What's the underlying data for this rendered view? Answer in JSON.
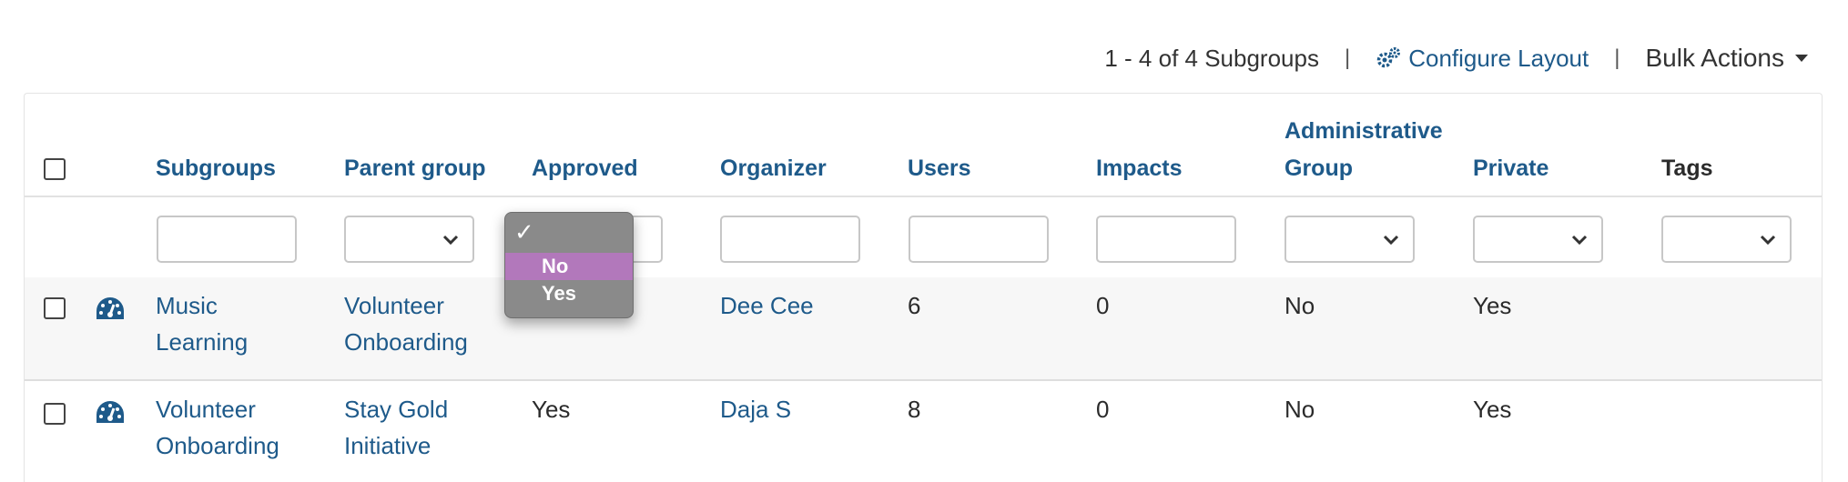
{
  "toolbar": {
    "count_text": "1 - 4 of 4 Subgroups",
    "separator": "|",
    "configure_label": "Configure Layout",
    "configure_icon": "gears-icon",
    "bulk_label": "Bulk Actions"
  },
  "columns": {
    "subgroups": "Subgroups",
    "parent_group": "Parent group",
    "approved": "Approved",
    "organizer": "Organizer",
    "users": "Users",
    "impacts": "Impacts",
    "admin_line1": "Administrative",
    "admin_line2": "Group",
    "private": "Private",
    "tags": "Tags"
  },
  "approved_dropdown": {
    "check": "✓",
    "options": [
      "No",
      "Yes"
    ],
    "highlighted": "No"
  },
  "rows": [
    {
      "subgroup_line1": "Music",
      "subgroup_line2": "Learning",
      "parent_line1": "Volunteer",
      "parent_line2": "Onboarding",
      "approved": "",
      "organizer": "Dee Cee",
      "users": "6",
      "impacts": "0",
      "admin_group": "No",
      "private": "Yes",
      "tags": ""
    },
    {
      "subgroup_line1": "Volunteer",
      "subgroup_line2": "Onboarding",
      "parent_line1": "Stay Gold",
      "parent_line2": "Initiative",
      "approved": "Yes",
      "organizer": "Daja S",
      "users": "8",
      "impacts": "0",
      "admin_group": "No",
      "private": "Yes",
      "tags": ""
    }
  ],
  "colors": {
    "link": "#1e5a8a",
    "highlight": "#b278bb",
    "popup_bg": "#8a8a8a"
  }
}
